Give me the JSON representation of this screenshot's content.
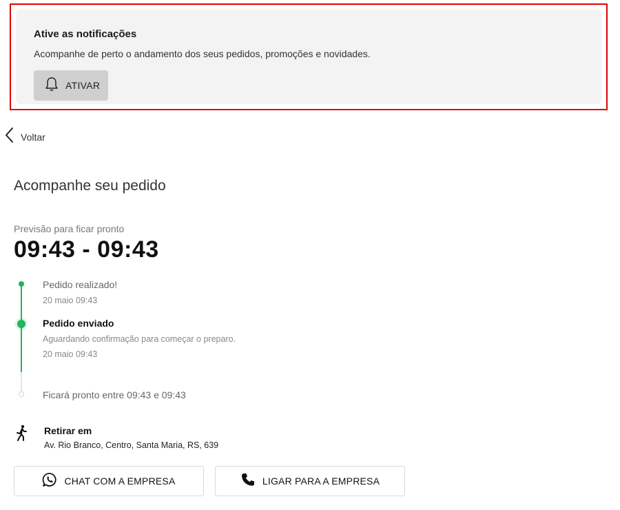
{
  "notification": {
    "title": "Ative as notificações",
    "text": "Acompanhe de perto o andamento dos seus pedidos, promoções e novidades.",
    "button_label": "ATIVAR",
    "button_icon": "bell-icon",
    "highlight_color": "#e00000"
  },
  "nav": {
    "back_label": "Voltar",
    "back_icon": "chevron-left-icon"
  },
  "page": {
    "title": "Acompanhe seu pedido",
    "eta_caption": "Previsão para ficar pronto",
    "eta_value": "09:43 - 09:43"
  },
  "timeline": {
    "accent_color": "#21b35f",
    "steps": [
      {
        "title": "Pedido realizado!",
        "description": "",
        "time": "20 maio 09:43",
        "state": "done"
      },
      {
        "title": "Pedido enviado",
        "description": "Aguardando confirmação para começar o preparo.",
        "time": "20 maio 09:43",
        "state": "current"
      },
      {
        "title": "Ficará pronto entre 09:43 e 09:43",
        "description": "",
        "time": "",
        "state": "pending"
      }
    ]
  },
  "pickup": {
    "icon": "walking-person-icon",
    "title": "Retirar em",
    "address": "Av. Rio Branco, Centro, Santa Maria, RS, 639"
  },
  "actions": {
    "chat_label": "CHAT COM A EMPRESA",
    "chat_icon": "whatsapp-icon",
    "call_label": "LIGAR PARA A EMPRESA",
    "call_icon": "phone-icon"
  }
}
